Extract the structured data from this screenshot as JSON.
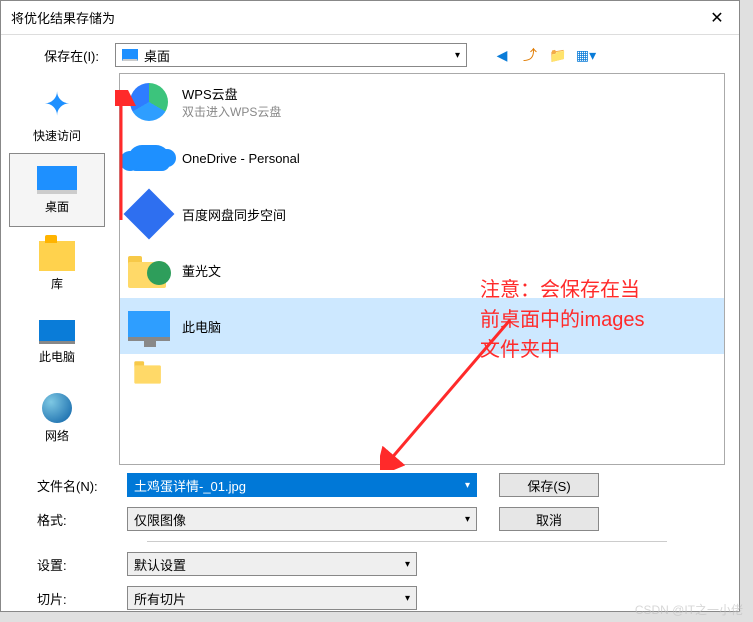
{
  "title": "将优化结果存储为",
  "save_in_label": "保存在(I):",
  "location_value": "桌面",
  "toolbar_icons": {
    "back": "back-icon",
    "up": "up-icon",
    "newfolder": "new-folder-icon",
    "view": "view-menu-icon"
  },
  "sidebar": [
    {
      "id": "quick",
      "label": "快速访问"
    },
    {
      "id": "desktop",
      "label": "桌面"
    },
    {
      "id": "libraries",
      "label": "库"
    },
    {
      "id": "thispc",
      "label": "此电脑"
    },
    {
      "id": "network",
      "label": "网络"
    }
  ],
  "list": [
    {
      "id": "wps",
      "title": "WPS云盘",
      "sub": "双击进入WPS云盘"
    },
    {
      "id": "onedrive",
      "title": "OneDrive - Personal",
      "sub": ""
    },
    {
      "id": "baidu",
      "title": "百度网盘同步空间",
      "sub": ""
    },
    {
      "id": "user",
      "title": "董光文",
      "sub": ""
    },
    {
      "id": "thispc",
      "title": "此电脑",
      "sub": ""
    }
  ],
  "form": {
    "filename_label": "文件名(N):",
    "filename_value": "土鸡蛋详情-_01.jpg",
    "format_label": "格式:",
    "format_value": "仅限图像",
    "settings_label": "设置:",
    "settings_value": "默认设置",
    "slice_label": "切片:",
    "slice_value": "所有切片",
    "save_btn": "保存(S)",
    "cancel_btn": "取消"
  },
  "annotation": {
    "l1": "注意：会保存在当",
    "l2": "前桌面中的images",
    "l3": "文件夹中"
  },
  "watermark": "CSDN @IT之一小佬"
}
